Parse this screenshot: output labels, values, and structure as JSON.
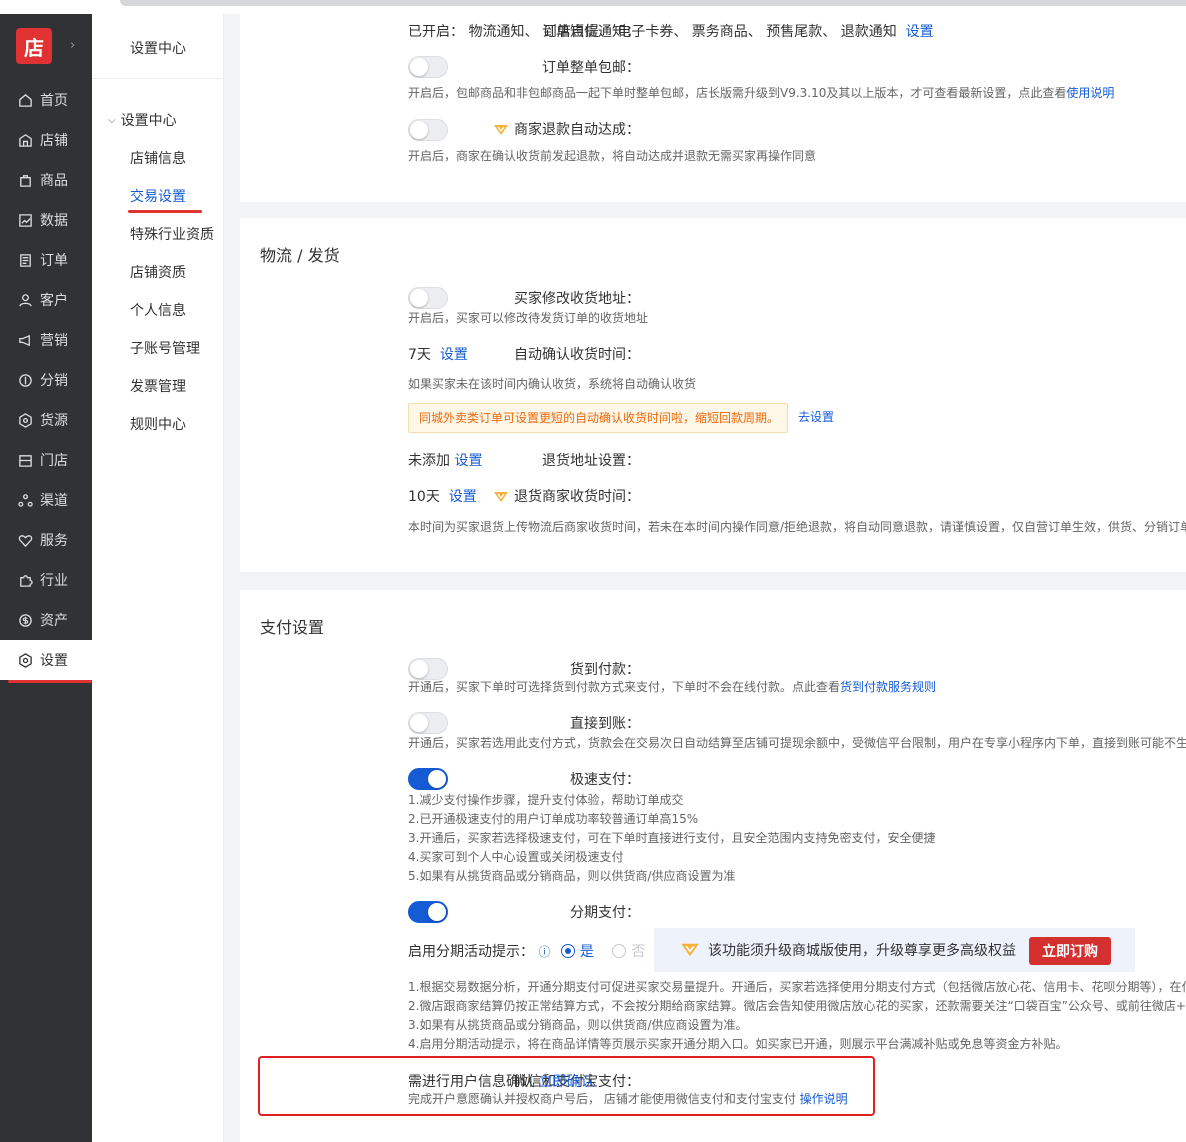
{
  "colors": {
    "nav_bg": "#303236",
    "accent_blue": "#155bd4",
    "highlight_red": "#e03232",
    "notice_orange": "#ed6a0c"
  },
  "logo": {
    "text": "店",
    "expand_icon": "chevron-right-icon"
  },
  "main_nav": [
    {
      "label": "首页",
      "icon": "home-icon"
    },
    {
      "label": "店铺",
      "icon": "store-icon"
    },
    {
      "label": "商品",
      "icon": "bag-icon"
    },
    {
      "label": "数据",
      "icon": "chart-icon"
    },
    {
      "label": "订单",
      "icon": "order-icon"
    },
    {
      "label": "客户",
      "icon": "user-icon"
    },
    {
      "label": "营销",
      "icon": "megaphone-icon"
    },
    {
      "label": "分销",
      "icon": "share-icon"
    },
    {
      "label": "货源",
      "icon": "supply-icon"
    },
    {
      "label": "门店",
      "icon": "shop-icon"
    },
    {
      "label": "渠道",
      "icon": "channel-icon"
    },
    {
      "label": "服务",
      "icon": "heart-icon"
    },
    {
      "label": "行业",
      "icon": "puzzle-icon"
    },
    {
      "label": "资产",
      "icon": "dollar-icon"
    },
    {
      "label": "设置",
      "icon": "gear-icon",
      "active": true
    }
  ],
  "sub_nav": {
    "title": "设置中心",
    "group": "设置中心",
    "items": [
      "店铺信息",
      "交易设置",
      "特殊行业资质",
      "店铺资质",
      "个人信息",
      "子账号管理",
      "发票管理",
      "规则中心"
    ],
    "active_index": 1
  },
  "top_section": {
    "sms": {
      "label": "订单短信通知：",
      "value": "已开启：  物流通知、 到店自提、 电子卡券、 票务商品、 预售尾款、 退款通知",
      "link": "设置"
    },
    "bundle_shipping": {
      "label": "订单整单包邮：",
      "on": false,
      "desc": "开启后，包邮商品和非包邮商品一起下单时整单包邮，店长版需升级到V9.3.10及其以上版本，才可查看最新设置，点此查看",
      "desc_link": "使用说明"
    },
    "auto_refund": {
      "label": "商家退款自动达成：",
      "on": false,
      "desc": "开启后，商家在确认收货前发起退款，将自动达成并退款无需买家再操作同意"
    }
  },
  "logistics": {
    "title": "物流 / 发货",
    "modify_address": {
      "label": "买家修改收货地址：",
      "on": false,
      "desc": "开启后，买家可以修改待发货订单的收货地址"
    },
    "auto_confirm": {
      "label": "自动确认收货时间：",
      "value": "7天",
      "link": "设置",
      "desc": "如果买家未在该时间内确认收货，系统将自动确认收货",
      "notice": "同城外卖类订单可设置更短的自动确认收货时间啦，缩短回款周期。",
      "notice_link": "去设置"
    },
    "return_address": {
      "label": "退货地址设置：",
      "value": "未添加",
      "link": "设置"
    },
    "return_receive": {
      "label": "退货商家收货时间：",
      "value": "10天",
      "link": "设置",
      "desc": "本时间为买家退货上传物流后商家收货时间，若未在本时间内操作同意/拒绝退款，将自动同意退款，请谨慎设置，仅自营订单生效，供货、分销订单"
    }
  },
  "payment": {
    "title": "支付设置",
    "cod": {
      "label": "货到付款：",
      "on": false,
      "desc": "开通后，买家下单时可选择货到付款方式来支付，下单时不会在线付款。点此查看",
      "desc_link": "货到付款服务规则"
    },
    "direct": {
      "label": "直接到账：",
      "on": false,
      "desc": "开通后，买家若选用此支付方式，货款会在交易次日自动结算至店铺可提现余额中，受微信平台限制，用户在专享小程序内下单，直接到账可能不生"
    },
    "fast": {
      "label": "极速支付：",
      "on": true,
      "lines": [
        "1.减少支付操作步骤，提升支付体验，帮助订单成交",
        "2.已开通极速支付的用户订单成功率较普通订单高15%",
        "3.开通后，买家若选择极速支付，可在下单时直接进行支付，且安全范围内支持免密支付，安全便捷",
        "4.买家可到个人中心设置或关闭极速支付",
        "5.如果有从挑货商品或分销商品，则以供货商/供应商设置为准"
      ]
    },
    "installment": {
      "label": "分期支付：",
      "on": true,
      "promo_label": "启用分期活动提示：",
      "info_icon": "info-icon",
      "yes": "是",
      "no": "否",
      "upgrade_text": "该功能须升级商城版使用，升级尊享更多高级权益",
      "upgrade_btn": "立即订购",
      "lines": [
        "1.根据交易数据分析，开通分期支付可促进买家交易量提升。开通后，买家若选择使用分期支付方式（包括微店放心花、信用卡、花呗分期等），在付",
        "2.微店跟商家结算仍按正常结算方式，不会按分期给商家结算。微店会告知使用微店放心花的买家，还款需要关注“口袋百宝”公众号、或前往微店+小",
        "3.如果有从挑货商品或分销商品，则以供货商/供应商设置为准。",
        "4.启用分期活动提示，将在商品详情等页展示买家开通分期入口。如买家已开通，则展示平台满减补贴或免息等资金方补贴。"
      ]
    },
    "wechat_alipay": {
      "label": "微信和支付宝支付：",
      "value": "需进行用户信息确认",
      "link": "立即确认",
      "desc": "完成开户意愿确认并授权商户号后，  店铺才能使用微信支付和支付宝支付",
      "desc_link": "操作说明"
    }
  }
}
